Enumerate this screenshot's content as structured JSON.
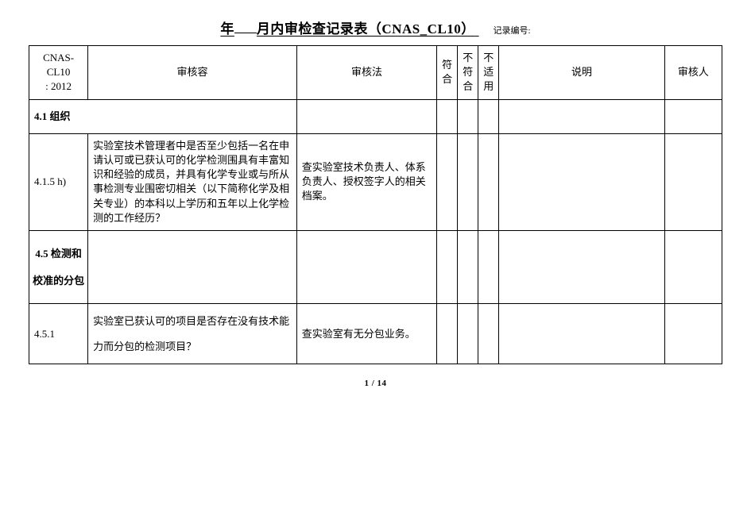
{
  "title": {
    "prefix": "年",
    "suffix": "月内审检查记录表（CNAS_CL10）",
    "record_label": "记录编号:"
  },
  "headers": {
    "col0_line1": "CNAS-CL10",
    "col0_line2": ": 2012",
    "col1": "审核容",
    "col2": "审核法",
    "col3": "符合",
    "col4": "不符合",
    "col5": "不适用",
    "col6": "说明",
    "col7": "审核人"
  },
  "rows": [
    {
      "type": "section",
      "label": "4.1  组织"
    },
    {
      "type": "item",
      "clause": "4.1.5  h)",
      "content": "实验室技术管理者中是否至少包括一名在申请认可或已获认可的化学检测围具有丰富知识和经验的成员，并具有化学专业或与所从事检测专业围密切相关（以下简称化学及相关专业）的本科以上学历和五年以上化学检测的工作经历？",
      "method": "查实验室技术负责人、体系负责人、授权签字人的相关档案。",
      "conform": "",
      "nonconform": "",
      "na": "",
      "note": "",
      "auditor": ""
    },
    {
      "type": "section45",
      "label": "4.5 检测和校准的分包"
    },
    {
      "type": "item",
      "clause": "4.5.1",
      "content": "实验室已获认可的项目是否存在没有技术能力而分包的检测项目？",
      "method": "查实验室有无分包业务。",
      "conform": "",
      "nonconform": "",
      "na": "",
      "note": "",
      "auditor": ""
    }
  ],
  "footer": {
    "page": "1 / 14"
  }
}
